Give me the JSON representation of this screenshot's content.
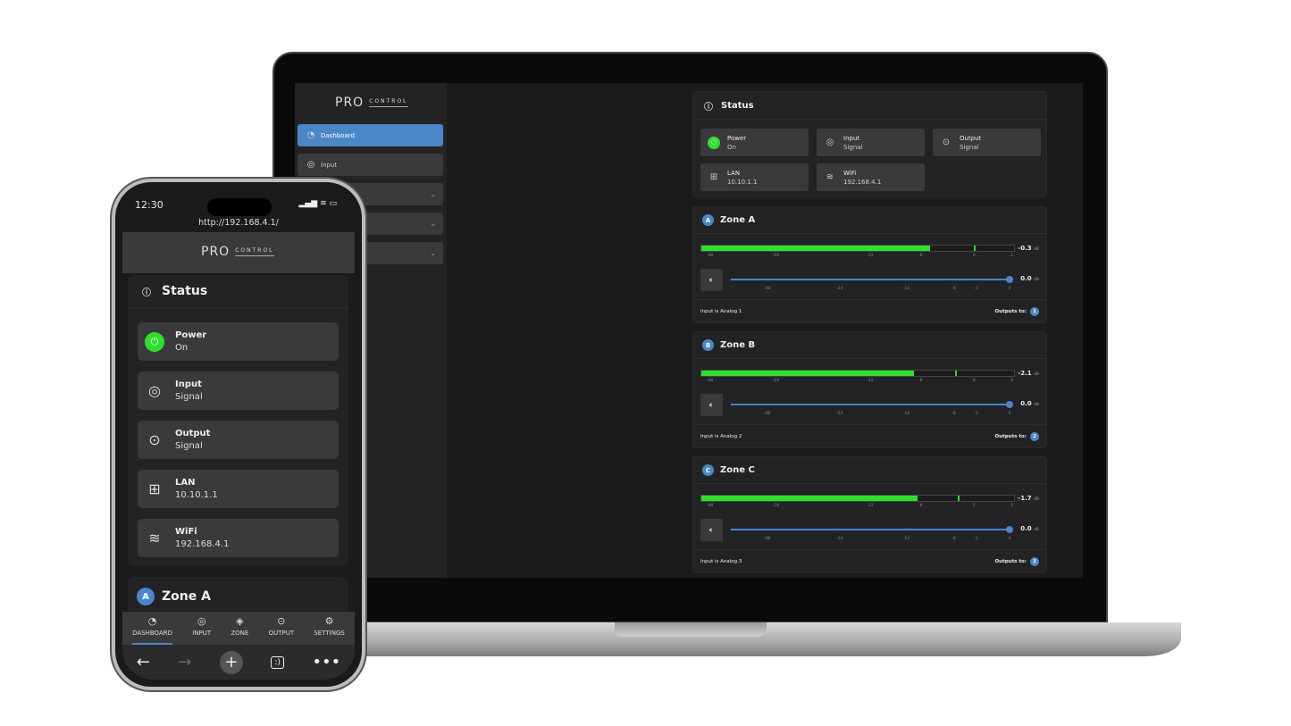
{
  "logo": {
    "text": "PRO",
    "sub": "CONTROL"
  },
  "sidebar": {
    "items": [
      {
        "label": "Dashboard",
        "icon": "gauge-icon",
        "active": true
      },
      {
        "label": "Input",
        "icon": "input-icon"
      },
      {
        "label": ""
      },
      {
        "label": ""
      },
      {
        "label": ""
      }
    ]
  },
  "status": {
    "title": "Status",
    "items": [
      {
        "label": "Power",
        "value": "On",
        "icon": "power-icon"
      },
      {
        "label": "Input",
        "value": "Signal",
        "icon": "input-icon"
      },
      {
        "label": "Output",
        "value": "Signal",
        "icon": "output-icon"
      },
      {
        "label": "LAN",
        "value": "10.10.1.1",
        "icon": "lan-icon"
      },
      {
        "label": "WiFi",
        "value": "192.168.4.1",
        "icon": "wifi-icon"
      }
    ]
  },
  "meter_ticks": [
    "-48",
    "-24",
    "-12",
    "-6",
    "0",
    "3"
  ],
  "slider_ticks": [
    "-48",
    "-24",
    "-12",
    "-6",
    "-3",
    "0"
  ],
  "db_unit": "dB",
  "outputs_label": "Outputs to:",
  "zones": [
    {
      "letter": "A",
      "name": "Zone A",
      "level": "-0.3",
      "level_fill": 0.73,
      "peak": 0.87,
      "volume": "0.0",
      "volume_fraction": 1.0,
      "input": "Input is Analog 1",
      "output": "1"
    },
    {
      "letter": "B",
      "name": "Zone B",
      "level": "-2.1",
      "level_fill": 0.68,
      "peak": 0.81,
      "volume": "0.0",
      "volume_fraction": 1.0,
      "input": "Input is Analog 2",
      "output": "2"
    },
    {
      "letter": "C",
      "name": "Zone C",
      "level": "-1.7",
      "level_fill": 0.69,
      "peak": 0.82,
      "volume": "0.0",
      "volume_fraction": 1.0,
      "input": "Input is Analog 3",
      "output": "3"
    }
  ],
  "phone": {
    "time": "12:30",
    "url": "http://192.168.4.1/",
    "zone_a": "Zone A",
    "zone_a_letter": "A",
    "nav": [
      {
        "label": "DASHBOARD",
        "icon": "gauge-icon"
      },
      {
        "label": "INPUT",
        "icon": "input-icon"
      },
      {
        "label": "ZONE",
        "icon": "speaker-icon"
      },
      {
        "label": "OUTPUT",
        "icon": "output-icon"
      },
      {
        "label": "SETTINGS",
        "icon": "gear-icon"
      }
    ]
  },
  "colors": {
    "accent": "#4a86c8",
    "meter": "#2ee02e",
    "bg": "#1b1b1d",
    "card": "#232325",
    "tile": "#3a3a3c"
  }
}
